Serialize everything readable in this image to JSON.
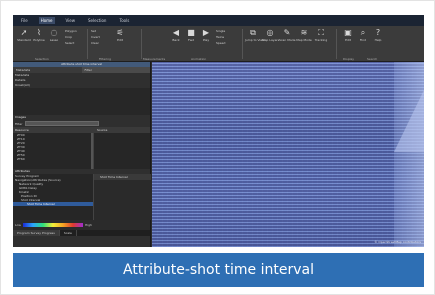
{
  "menu": [
    "File",
    "Home",
    "View",
    "Selection",
    "Tools"
  ],
  "menu_active": 1,
  "ribbon": {
    "selection_buttons": [
      "Standard",
      "Polyline",
      "Lasso"
    ],
    "selection_small": [
      "Polygon",
      "Crop",
      "Select"
    ],
    "selection_caption": "Selection",
    "filter_small": [
      "Set",
      "Invert",
      "Clear"
    ],
    "filter_caption": "Filtering",
    "tools_buttons": [
      "Edit"
    ],
    "measure_caption": "Measurements",
    "nav_buttons": [
      "Back",
      "Fwd",
      "Play"
    ],
    "nav_small": [
      "Single",
      "Twins",
      "Speed"
    ],
    "nav_caption": "Animation",
    "view_buttons": [
      "Jump to View",
      "Map Layers",
      "Scan Mode",
      "Map Mode",
      "Tracking"
    ],
    "misc_buttons": [
      "Edit",
      "Find",
      "Help"
    ],
    "misc_caption": "Display",
    "search_caption": "Search"
  },
  "left_panel": {
    "title": "Attribute shot time interval",
    "tabs": [
      "Metadata",
      "Filter"
    ],
    "metadata_label": "Metadata",
    "details_label": "Details",
    "details_value": "Unset(All)",
    "images_label": "Images",
    "filter_label": "Filter",
    "list_columns": [
      "Resource",
      "Source"
    ],
    "list_items": [
      "ZT00",
      "ZT10",
      "ZT20",
      "ZT30",
      "ZT40",
      "ZT50",
      "ZT60"
    ],
    "attributes_label": "Attributes",
    "tree_items": [
      "Survey Program",
      "Navigation/Attributes (Source)",
      "Network Quality",
      "GNSS Delay",
      "Kinetic",
      "Position ID",
      "Shot Interval",
      "Shot Time Interval"
    ],
    "tree_selected": 7,
    "detail_header": "Shot Time Interval",
    "legend_low": "Low",
    "legend_high": "High",
    "bottom_tabs": [
      "Program Survey Progress",
      "Scale"
    ]
  },
  "viewport": {
    "attribution": "© OpenStreetMap contributors"
  },
  "caption": "Attribute-shot time interval"
}
